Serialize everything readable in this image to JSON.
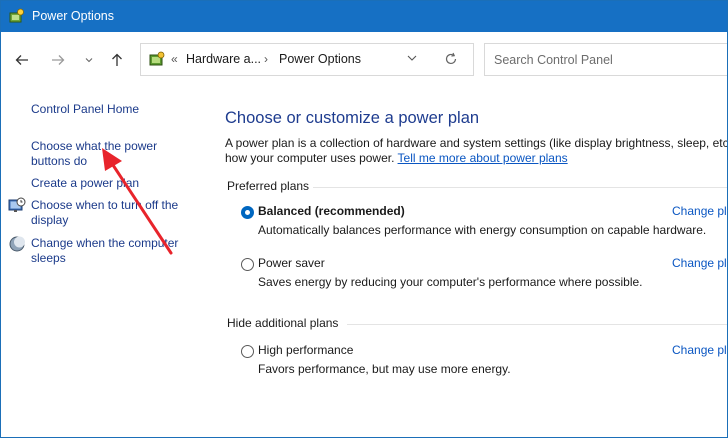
{
  "window": {
    "title": "Power Options",
    "colors": {
      "titlebar": "#1670c4",
      "link": "#1b3a8a",
      "heading": "#1e3c8f",
      "accent": "#0067c0",
      "annotation_arrow": "#e8242b"
    }
  },
  "nav": {
    "back_icon": "arrow-left-icon",
    "forward_icon": "arrow-right-icon",
    "recent_icon": "chevron-down-icon",
    "up_icon": "arrow-up-icon"
  },
  "address": {
    "overflow": "«",
    "crumbs": [
      "Hardware a...",
      "Power Options"
    ],
    "separator": "›",
    "dropdown_icon": "chevron-down-icon",
    "refresh_icon": "refresh-icon"
  },
  "search": {
    "placeholder": "Search Control Panel"
  },
  "sidebar": {
    "home": "Control Panel Home",
    "items": [
      {
        "label_line1": "Choose what the power",
        "label_line2": "buttons do",
        "icon": ""
      },
      {
        "label_line1": "Create a power plan",
        "label_line2": "",
        "icon": ""
      },
      {
        "label_line1": "Choose when to turn off the",
        "label_line2": "display",
        "icon": "monitor-clock-icon"
      },
      {
        "label_line1": "Change when the computer",
        "label_line2": "sleeps",
        "icon": "moon-icon"
      }
    ]
  },
  "main": {
    "title": "Choose or customize a power plan",
    "description_line1": "A power plan is a collection of hardware and system settings (like display brightness, sleep, etc.) tha",
    "description_line2": "how your computer uses power.",
    "learn_more": "Tell me more about power plans",
    "preferred_heading": "Preferred plans",
    "hidden_heading": "Hide additional plans",
    "plans": [
      {
        "name": "Balanced (recommended)",
        "description": "Automatically balances performance with energy consumption on capable hardware.",
        "selected": true,
        "change_label": "Change pla"
      },
      {
        "name": "Power saver",
        "description": "Saves energy by reducing your computer's performance where possible.",
        "selected": false,
        "change_label": "Change pla"
      },
      {
        "name": "High performance",
        "description": "Favors performance, but may use more energy.",
        "selected": false,
        "change_label": "Change pla"
      }
    ]
  }
}
